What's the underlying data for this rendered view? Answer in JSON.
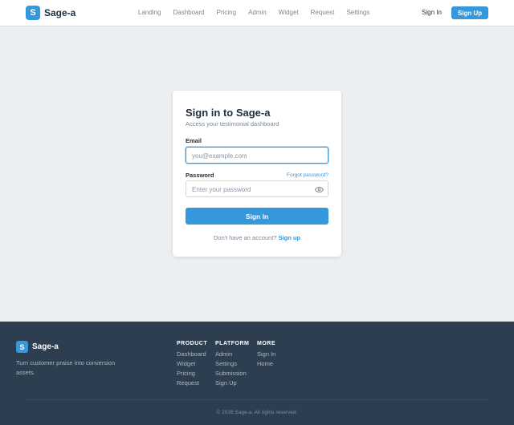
{
  "header": {
    "logo_letter": "S",
    "brand": "Sage-a",
    "nav": [
      "Landing",
      "Dashboard",
      "Pricing",
      "Admin",
      "Widget",
      "Request",
      "Settings"
    ],
    "signin": "Sign In",
    "signup": "Sign Up"
  },
  "card": {
    "title": "Sign in to Sage-a",
    "subtitle": "Access your testimonial dashboard",
    "email_label": "Email",
    "email_placeholder": "you@example.com",
    "password_label": "Password",
    "forgot": "Forgot password?",
    "password_placeholder": "Enter your password",
    "submit": "Sign In",
    "no_account": "Don't have an account?",
    "signup_link": "Sign up"
  },
  "footer": {
    "logo_letter": "S",
    "brand": "Sage-a",
    "tagline": "Turn customer praise into conversion assets.",
    "columns": [
      {
        "title": "PRODUCT",
        "items": [
          "Dashboard",
          "Widget",
          "Pricing",
          "Request"
        ]
      },
      {
        "title": "PLATFORM",
        "items": [
          "Admin",
          "Settings",
          "Submission",
          "Sign Up"
        ]
      },
      {
        "title": "MORE",
        "items": [
          "Sign In",
          "Home"
        ]
      }
    ],
    "copyright": "© 2026 Sage-a. All rights reserved."
  },
  "colors": {
    "accent": "#3498db",
    "footer_bg": "#2c3e50",
    "page_bg": "#eceff1"
  }
}
